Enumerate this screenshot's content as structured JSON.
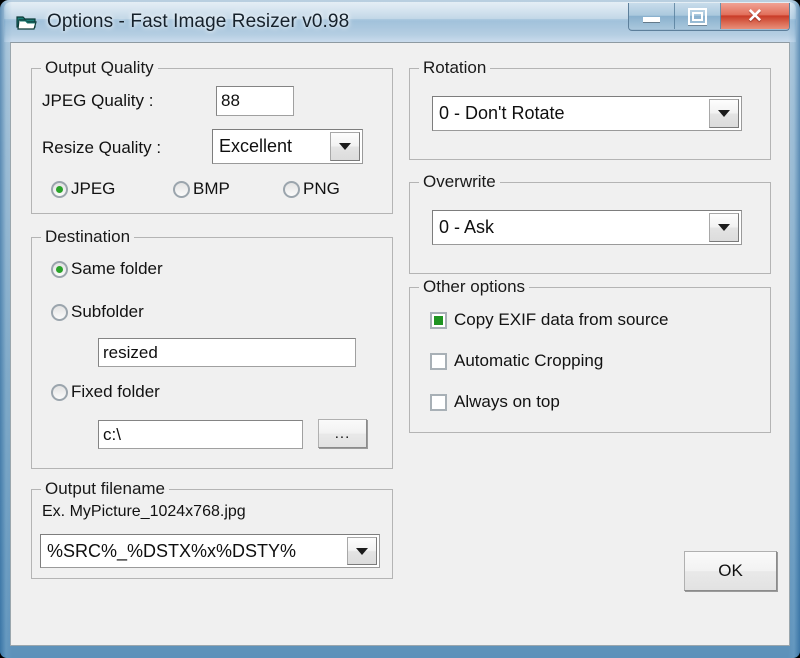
{
  "window": {
    "title": "Options - Fast Image Resizer v0.98",
    "icon": "folder-stack-icon",
    "caption_buttons": {
      "minimize": "minimize-icon",
      "maximize": "maximize-icon",
      "close": "✕"
    },
    "accent_close": "#c93c28",
    "accent_check": "#1f9421"
  },
  "output_quality": {
    "title": "Output Quality",
    "jpeg_quality_label": "JPEG Quality :",
    "jpeg_quality_value": "88",
    "resize_quality_label": "Resize Quality :",
    "resize_quality_value": "Excellent",
    "formats": [
      {
        "label": "JPEG",
        "checked": true
      },
      {
        "label": "BMP",
        "checked": false
      },
      {
        "label": "PNG",
        "checked": false
      }
    ]
  },
  "destination": {
    "title": "Destination",
    "options": [
      {
        "label": "Same folder",
        "checked": true
      },
      {
        "label": "Subfolder",
        "checked": false
      },
      {
        "label": "Fixed folder",
        "checked": false
      }
    ],
    "subfolder_value": "resized",
    "fixed_folder_value": "c:\\",
    "browse_label": "..."
  },
  "output_filename": {
    "title": "Output filename",
    "example_label": "Ex. MyPicture_1024x768.jpg",
    "pattern_value": "%SRC%_%DSTX%x%DSTY%"
  },
  "rotation": {
    "title": "Rotation",
    "value": "0 - Don't Rotate"
  },
  "overwrite": {
    "title": "Overwrite",
    "value": "0 - Ask"
  },
  "other_options": {
    "title": "Other options",
    "items": [
      {
        "label": "Copy EXIF data from source",
        "checked": true
      },
      {
        "label": "Automatic Cropping",
        "checked": false
      },
      {
        "label": "Always on top",
        "checked": false
      }
    ]
  },
  "footer": {
    "ok_label": "OK"
  }
}
